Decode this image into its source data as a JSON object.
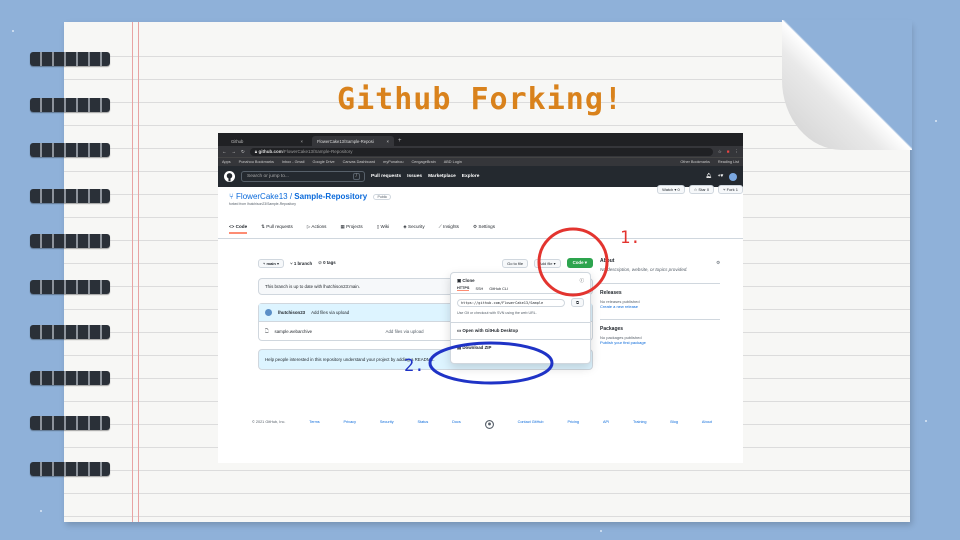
{
  "slide": {
    "title": "Github Forking!"
  },
  "browser": {
    "tabs": [
      "Github",
      "FlowerCake13/Sample-Reposi"
    ],
    "new_tab": "+",
    "url_host": "github.com",
    "url_path": "/FlowerCake13/Sample-Repository",
    "bookmarks": [
      "Apps",
      "Punahou Bookmarks",
      "Inbox - Gmail",
      "Google Drive",
      "Canvas Dashboard",
      "myPunahou",
      "CengageBrain",
      "ABD Login"
    ],
    "bookmarks_right": [
      "Other Bookmarks",
      "Reading List"
    ]
  },
  "github_nav": {
    "search_placeholder": "Search or jump to...",
    "search_key": "/",
    "links": [
      "Pull requests",
      "Issues",
      "Marketplace",
      "Explore"
    ]
  },
  "repo": {
    "owner": "FlowerCake13",
    "separator": " / ",
    "name": "Sample-Repository",
    "visibility": "Public",
    "forked_from": "forked from lhutchison23/Sample-Repository",
    "watch": "Watch",
    "watch_count": "0",
    "star": "Star",
    "star_count": "0",
    "fork": "Fork",
    "fork_count": "1",
    "tabs": [
      "Code",
      "Pull requests",
      "Actions",
      "Projects",
      "Wiki",
      "Security",
      "Insights",
      "Settings"
    ]
  },
  "code": {
    "branch": "main",
    "branches": "1 branch",
    "tags": "0 tags",
    "goto_file": "Go to file",
    "add_file": "Add file",
    "code_button": "Code",
    "up_to_date": "This branch is up to date with lhutchison23:main.",
    "commit_author": "lhutchison23",
    "commit_message": "Add files via upload",
    "files": [
      {
        "name": "sample.webarchive",
        "message": "Add files via upload"
      }
    ],
    "readme_prompt": "Help people interested in this repository understand your project by adding a README."
  },
  "clone_dropdown": {
    "title": "Clone",
    "protocols": [
      "HTTPS",
      "SSH",
      "GitHub CLI"
    ],
    "url": "https://github.com/FlowerCake13/Sample",
    "help": "Use Git or checkout with SVN using the web URL.",
    "open_desktop": "Open with GitHub Desktop",
    "download_zip": "Download ZIP"
  },
  "about": {
    "title": "About",
    "description": "No description, website, or topics provided.",
    "releases_title": "Releases",
    "releases_text": "No releases published",
    "releases_link": "Create a new release",
    "packages_title": "Packages",
    "packages_text": "No packages published",
    "packages_link": "Publish your first package"
  },
  "footer": {
    "copyright": "© 2021 GitHub, Inc.",
    "links": [
      "Terms",
      "Privacy",
      "Security",
      "Status",
      "Docs",
      "Contact GitHub",
      "Pricing",
      "API",
      "Training",
      "Blog",
      "About"
    ]
  },
  "annotations": {
    "step1": "1.",
    "step2": "2."
  },
  "colors": {
    "annotation_red": "#e3342f",
    "annotation_blue": "#1f33c6",
    "title_orange": "#d9821c",
    "github_green": "#2da44e"
  }
}
